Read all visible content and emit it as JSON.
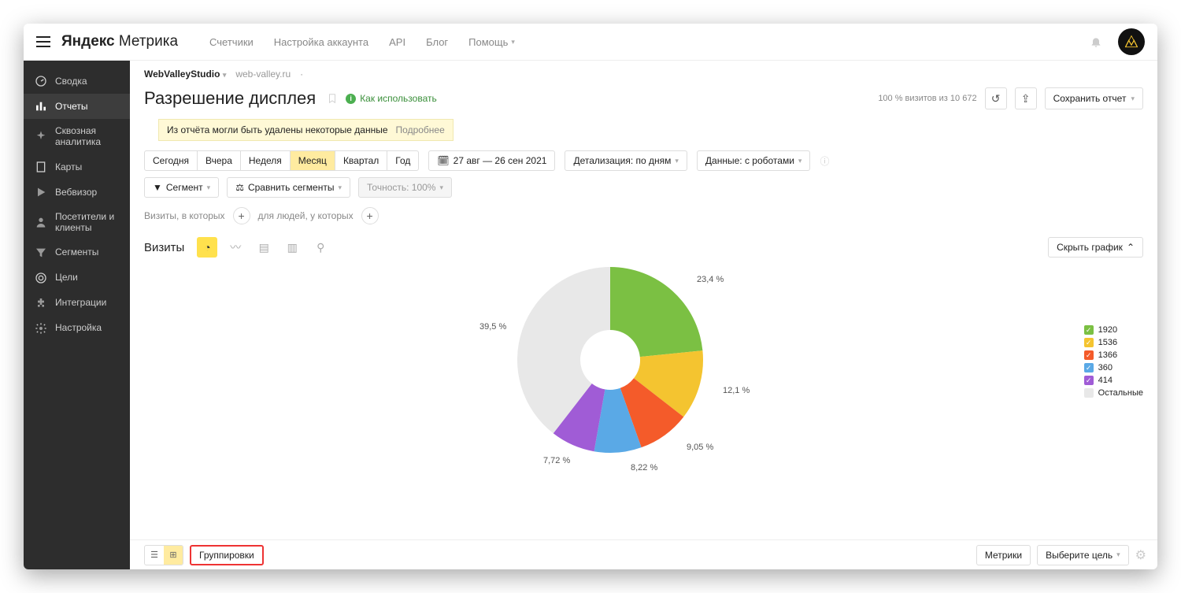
{
  "logo": {
    "brand": "Яндекс",
    "product": "Метрика"
  },
  "topnav": {
    "counters": "Счетчики",
    "account": "Настройка аккаунта",
    "api": "API",
    "blog": "Блог",
    "help": "Помощь"
  },
  "sidebar": {
    "items": [
      {
        "label": "Сводка"
      },
      {
        "label": "Отчеты"
      },
      {
        "label": "Сквозная аналитика"
      },
      {
        "label": "Карты"
      },
      {
        "label": "Вебвизор"
      },
      {
        "label": "Посетители и клиенты"
      },
      {
        "label": "Сегменты"
      },
      {
        "label": "Цели"
      },
      {
        "label": "Интеграции"
      },
      {
        "label": "Настройка"
      }
    ]
  },
  "breadcrumb": {
    "site": "WebValleyStudio",
    "domain": "web-valley.ru"
  },
  "page": {
    "title": "Разрешение дисплея",
    "howto": "Как использовать",
    "visits_stat": "100 % визитов из 10 672",
    "save": "Сохранить отчет"
  },
  "warning": {
    "text": "Из отчёта могли быть удалены некоторые данные",
    "more": "Подробнее"
  },
  "period": {
    "today": "Сегодня",
    "yesterday": "Вчера",
    "week": "Неделя",
    "month": "Месяц",
    "quarter": "Квартал",
    "year": "Год"
  },
  "daterange": "27 авг — 26 сен 2021",
  "detail": "Детализация: по дням",
  "data_robots": "Данные: с роботами",
  "segment_btn": "Сегмент",
  "compare_btn": "Сравнить сегменты",
  "precision_btn": "Точность: 100%",
  "filters": {
    "visits": "Визиты, в которых",
    "people": "для людей, у которых"
  },
  "viz": {
    "label": "Визиты",
    "hide": "Скрыть график"
  },
  "chart_data": {
    "type": "pie",
    "title": "Разрешение дисплея — Визиты",
    "series": [
      {
        "name": "1920",
        "value": 23.4,
        "color": "#7bc043"
      },
      {
        "name": "1536",
        "value": 12.1,
        "color": "#f4c430"
      },
      {
        "name": "1366",
        "value": 9.05,
        "color": "#f45b2a"
      },
      {
        "name": "360",
        "value": 8.22,
        "color": "#5aa9e6"
      },
      {
        "name": "414",
        "value": 7.72,
        "color": "#a05cd6"
      },
      {
        "name": "Остальные",
        "value": 39.5,
        "color": "#e8e8e8"
      }
    ],
    "labels": {
      "0": "23,4 %",
      "1": "12,1 %",
      "2": "9,05 %",
      "3": "8,22 %",
      "4": "7,72 %",
      "5": "39,5 %"
    }
  },
  "legend": {
    "items": [
      {
        "label": "1920",
        "color": "#7bc043",
        "check": true
      },
      {
        "label": "1536",
        "color": "#f4c430",
        "check": true
      },
      {
        "label": "1366",
        "color": "#f45b2a",
        "check": true
      },
      {
        "label": "360",
        "color": "#5aa9e6",
        "check": true
      },
      {
        "label": "414",
        "color": "#a05cd6",
        "check": true
      },
      {
        "label": "Остальные",
        "color": "#e8e8e8",
        "check": false
      }
    ]
  },
  "bottom": {
    "groupings": "Группировки",
    "metrics": "Метрики",
    "select_goal": "Выберите цель"
  }
}
